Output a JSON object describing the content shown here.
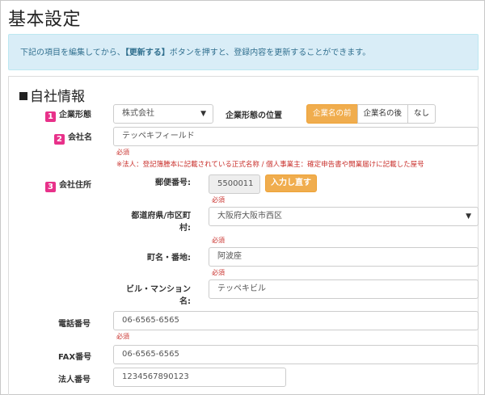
{
  "page": {
    "title": "基本設定"
  },
  "info": {
    "prefix": "下記の項目を編集してから、",
    "highlight": "【更新する】",
    "suffix": "ボタンを押すと、登録内容を更新することができます。"
  },
  "section": {
    "title": "自社情報"
  },
  "company_type": {
    "number": "1",
    "label": "企業形態",
    "selected": "株式会社",
    "position_label": "企業形態の位置",
    "positions": [
      "企業名の前",
      "企業名の後",
      "なし"
    ]
  },
  "company_name": {
    "number": "2",
    "label": "会社名",
    "value": "テッペキフィールド",
    "required": "必須",
    "note": "※法人：登記簿謄本に記載されている正式名称 / 個人事業主：確定申告書や開業届けに記載した屋号"
  },
  "address": {
    "number": "3",
    "label": "会社住所",
    "postal_label": "郵便番号:",
    "postal_value": "5500011",
    "postal_required": "必須",
    "reenter_button": "入力し直す",
    "prefecture_label_1": "都道府県/市区町",
    "prefecture_label_2": "村:",
    "prefecture_value": "大阪府大阪市西区",
    "prefecture_required": "必須",
    "town_label": "町名・番地:",
    "town_value": "阿波座",
    "town_required": "必須",
    "building_label_1": "ビル・マンション",
    "building_label_2": "名:",
    "building_value": "テッペキビル"
  },
  "phone": {
    "label": "電話番号",
    "value": "06-6565-6565",
    "required": "必須"
  },
  "fax": {
    "label": "FAX番号",
    "value": "06-6565-6565"
  },
  "corp_number": {
    "label": "法人番号",
    "value": "1234567890123"
  }
}
